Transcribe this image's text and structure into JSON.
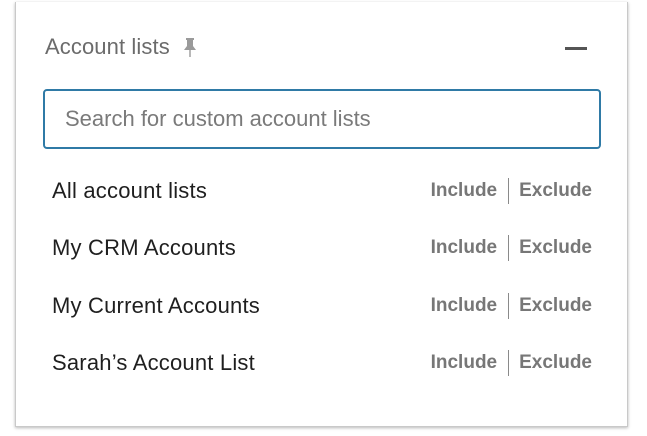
{
  "panel": {
    "title": "Account lists",
    "pin_icon": "pin-icon",
    "collapse_icon": "minus-icon"
  },
  "search": {
    "placeholder": "Search for custom account lists",
    "value": ""
  },
  "lists": [
    {
      "label": "All account lists",
      "include": "Include",
      "exclude": "Exclude"
    },
    {
      "label": "My CRM Accounts",
      "include": "Include",
      "exclude": "Exclude"
    },
    {
      "label": "My Current Accounts",
      "include": "Include",
      "exclude": "Exclude"
    },
    {
      "label": "Sarah’s Account List",
      "include": "Include",
      "exclude": "Exclude"
    }
  ],
  "colors": {
    "search_border": "#2f7aa6",
    "action_text": "#777777",
    "title_text": "#6b6b6b"
  }
}
